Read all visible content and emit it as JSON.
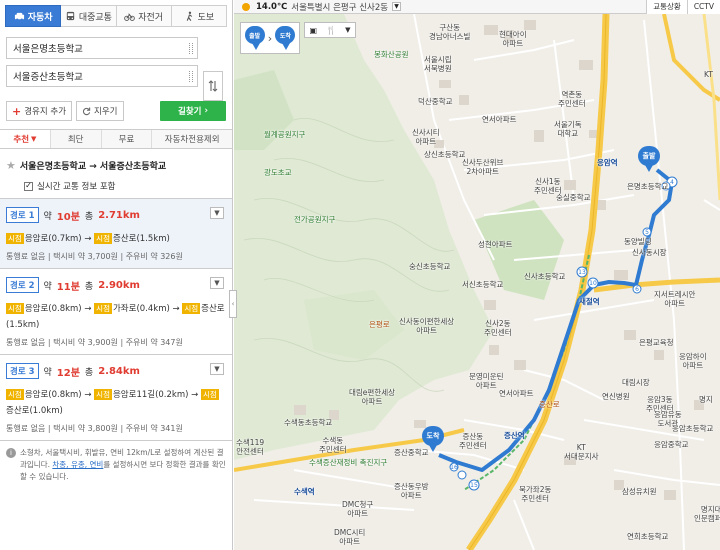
{
  "modes": [
    {
      "key": "car",
      "label": "자동차",
      "active": true
    },
    {
      "key": "transit",
      "label": "대중교통",
      "active": false
    },
    {
      "key": "bike",
      "label": "자전거",
      "active": false
    },
    {
      "key": "walk",
      "label": "도보",
      "active": false
    }
  ],
  "origin": {
    "value": "서울은명초등학교"
  },
  "destination": {
    "value": "서울증산초등학교"
  },
  "actions": {
    "add_waypoint": "경유지 추가",
    "clear": "지우기",
    "find_route": "길찾기"
  },
  "tabs": [
    {
      "label": "추천",
      "active": true
    },
    {
      "label": "최단",
      "active": false
    },
    {
      "label": "무료",
      "active": false
    },
    {
      "label": "자동차전용제외",
      "active": false
    }
  ],
  "summary": {
    "title": "서울은명초등학교 → 서울증산초등학교",
    "realtime_label": "실시간 교통 정보 포함"
  },
  "routes": [
    {
      "name": "경로 1",
      "time_prefix": "약",
      "time": "10분",
      "dist_prefix": "총",
      "dist": "2.71km",
      "road1_badge": "시점",
      "road1": "응암로(0.7km)",
      "road2_badge": "시점",
      "road2": "증산로(1.5km)",
      "stats": "통행료 없음 | 택시비 약 3,700원 | 주유비 약 326원"
    },
    {
      "name": "경로 2",
      "time_prefix": "약",
      "time": "11분",
      "dist_prefix": "총",
      "dist": "2.90km",
      "road1_badge": "시점",
      "road1": "응암로(0.8km)",
      "road2_badge": "시점",
      "road2": "가좌로(0.4km)",
      "road3_badge": "시점",
      "road3": "증산로(1.5km)",
      "stats": "통행료 없음 | 택시비 약 3,900원 | 주유비 약 347원"
    },
    {
      "name": "경로 3",
      "time_prefix": "약",
      "time": "12분",
      "dist_prefix": "총",
      "dist": "2.84km",
      "road1_badge": "시점",
      "road1": "응암로(0.8km)",
      "road2_badge": "시점",
      "road2": "응암로11길(0.2km)",
      "road3_badge": "시점",
      "road3": "증산로(1.0km)",
      "stats": "통행료 없음 | 택시비 약 3,800원 | 주유비 약 341원"
    }
  ],
  "note": {
    "text": "소형차, 서울택시비, 휘발유, 연비 12km/L로 설정하여 계산된 결과입니다.",
    "link": "차종, 유종, 연비",
    "text2": "를 설정하시면 보다 정확한 결과를 확인할 수 있습니다."
  },
  "map": {
    "temperature": "14.0℃",
    "location": "서울특별시 은평구 신사2동",
    "traffic_button": "교통상황",
    "cctv_button": "CCTV",
    "origin_pin": "출발",
    "dest_pin": "도착",
    "labels": {
      "gusan": "구산동\n경남아너스빌",
      "hyundai": "현대아이\n아파트",
      "seoulsi": "서울시립\n서북병원",
      "yeokchon": "역촌동\n주민센터",
      "kt": "KT",
      "deoksan": "덕산중학교",
      "yeonseo": "연서아파트",
      "seoulgi": "서울기독\n대학교",
      "sinsacity": "신사시티\n아파트",
      "sangsin": "상신초등학교",
      "sinsadusan": "신사두산위브\n2차아파트",
      "sinsa1": "신사1동\n주민센터",
      "sungshil": "숭실중학교",
      "eungam_st": "응암역",
      "eunmyeong": "은명초등학교",
      "seongheum": "성현아파트",
      "sinsaschool": "신사초등학교",
      "soongsin": "숭신초등학교",
      "seoseo": "서신초등학교",
      "dongyang": "동양빌딩",
      "sinsa_mkt": "신사동시장",
      "jise": "지서트레시안\n아파트",
      "sae_jeol": "새절역",
      "sinsaidong": "신사동이편한세상\n아파트",
      "sinsa2": "신사2동\n주민센터",
      "eunpyeong_ed": "은평교육청",
      "eungam_ha": "응암하이\n아파트",
      "moonyeong": "문영미운틴\n아파트",
      "yeonseo2": "연서아파트",
      "daelim": "대림e편한세상\n아파트",
      "suseong": "수색동초등학교",
      "daelim_s": "대림시장",
      "yeonsin": "연신병원",
      "eungam_3": "응암3동\n주민센터",
      "eungam_y": "응암유동\n도서관",
      "eungam_el": "응암초등학교",
      "eungam_mid": "응암중학교",
      "jeungsan_j": "증산중학교",
      "jeungsan_dong": "증산동\n주민센터",
      "jeungsan_st": "증산역",
      "susaek_119": "수색119\n안전센터",
      "susaek_ju": "수색동\n주민센터",
      "susaek_jae": "수색증산재정비 촉진지구",
      "dmc_jeungsan": "증산동우방\n아파트",
      "dmc": "DMC청구\n아파트",
      "dmc_si": "DMC시티\n아파트",
      "kt_seo": "KT\n서대문지사",
      "bukgajwa": "북가좌2동\n주민센터",
      "samsung": "삼성유치원",
      "yeonhui": "연희초등학교",
      "myeongji": "명지대\n인문캠퍼스",
      "susaek_st": "수색역",
      "bonghwasan": "봉화산공원",
      "gwangdo": "광도초교",
      "jeonggye": "전가공원지구",
      "eunpyeong_st": "은평로",
      "myeongji2": "명지",
      "jeungsan_ro": "증산로",
      "wolgye": "월계공원지구"
    }
  }
}
